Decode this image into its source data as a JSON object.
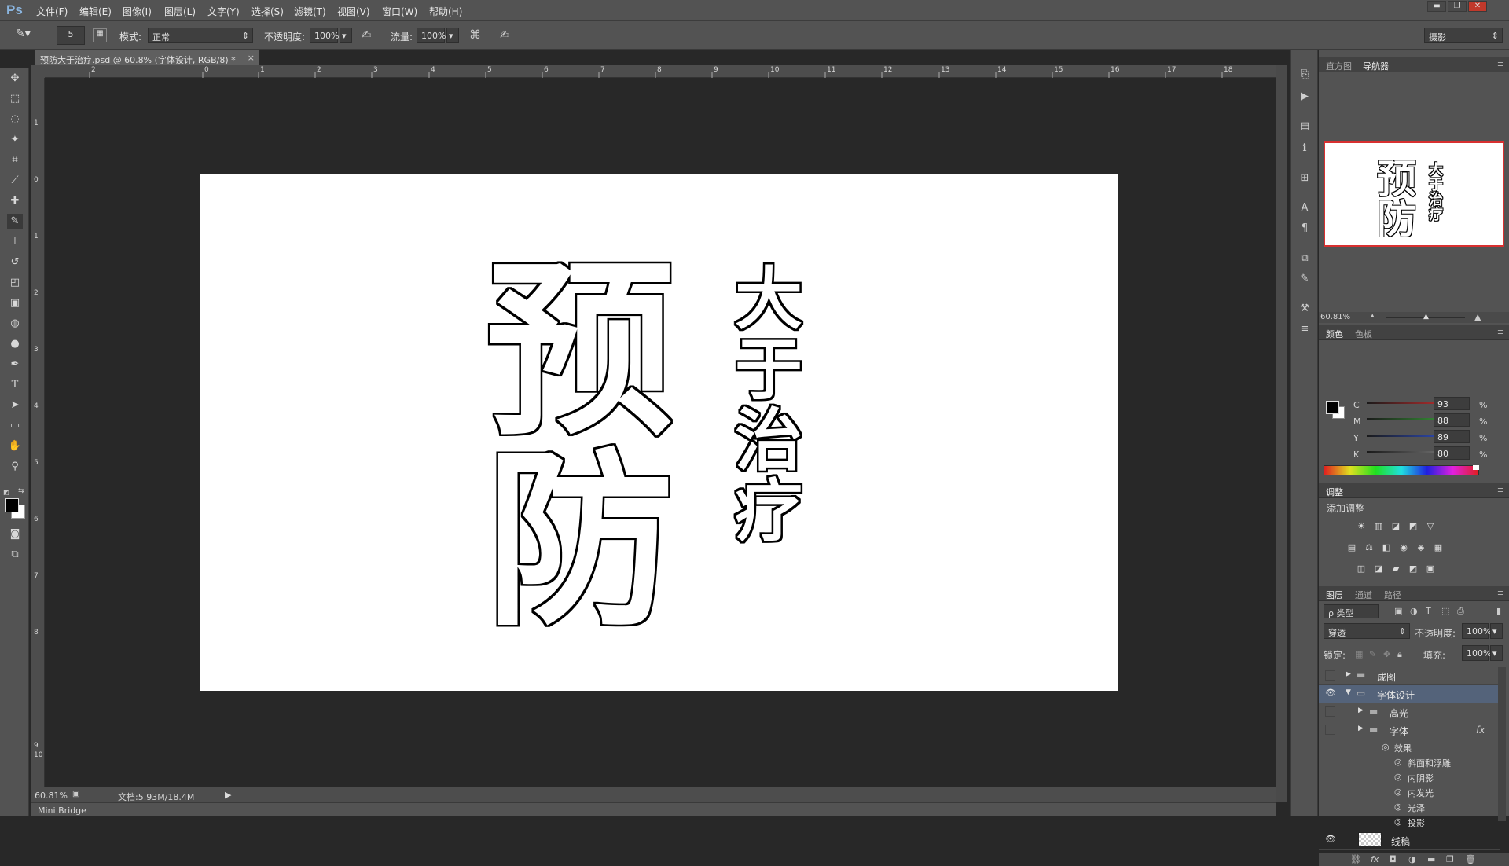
{
  "app": {
    "logo": "Ps"
  },
  "menu": [
    "文件(F)",
    "编辑(E)",
    "图像(I)",
    "图层(L)",
    "文字(Y)",
    "选择(S)",
    "滤镜(T)",
    "视图(V)",
    "窗口(W)",
    "帮助(H)"
  ],
  "window_controls": [
    "▬",
    "❐",
    "✕"
  ],
  "options": {
    "brush_size": "5",
    "mode_label": "模式:",
    "mode_value": "正常",
    "opacity_label": "不透明度:",
    "opacity_value": "100%",
    "flow_label": "流量:",
    "flow_value": "100%",
    "workspace": "摄影"
  },
  "document": {
    "tab_title": "预防大于治疗.psd @ 60.8% (字体设计, RGB/8) *",
    "ruler_h": [
      "2",
      "0",
      "1",
      "2",
      "3",
      "4",
      "5",
      "6",
      "7",
      "8",
      "9",
      "10",
      "11",
      "12",
      "13",
      "14",
      "15",
      "16",
      "17",
      "18"
    ],
    "ruler_v": [
      "1",
      "0",
      "1",
      "2",
      "3",
      "4",
      "5",
      "6",
      "7",
      "8",
      "9",
      "10"
    ]
  },
  "artwork": {
    "main_text_1": "预",
    "main_text_2": "防",
    "side_text": [
      "大",
      "于",
      "治",
      "疗"
    ]
  },
  "status": {
    "zoom": "60.81%",
    "doc_info": "文档:5.93M/18.4M",
    "mini_bridge": "Mini Bridge"
  },
  "navigator": {
    "tabs": [
      "直方图",
      "导航器"
    ],
    "zoom": "60.81%"
  },
  "color": {
    "tabs": [
      "颜色",
      "色板"
    ],
    "channels": [
      {
        "label": "C",
        "value": "93",
        "unit": "%",
        "color": "#c83030"
      },
      {
        "label": "M",
        "value": "88",
        "unit": "%",
        "color": "#3aa03a"
      },
      {
        "label": "Y",
        "value": "89",
        "unit": "%",
        "color": "#3050c8"
      },
      {
        "label": "K",
        "value": "80",
        "unit": "%",
        "color": "#7a7a7a"
      }
    ]
  },
  "adjustments": {
    "tab": "调整",
    "title": "添加调整",
    "row1": [
      "☀",
      "▥",
      "◪",
      "◩",
      "▽"
    ],
    "row2": [
      "▤",
      "⚖",
      "◧",
      "◉",
      "◈",
      "▦"
    ],
    "row3": [
      "◫",
      "◪",
      "▰",
      "◩",
      "▣"
    ]
  },
  "layers": {
    "tabs": [
      "图层",
      "通道",
      "路径"
    ],
    "filter_label": "ρ 类型",
    "blend_mode": "穿透",
    "opacity_label": "不透明度:",
    "opacity_value": "100%",
    "lock_label": "锁定:",
    "fill_label": "填充:",
    "fill_value": "100%",
    "items": [
      {
        "name": "成图",
        "visible": false,
        "type": "group",
        "level": 0,
        "expanded": false
      },
      {
        "name": "字体设计",
        "visible": true,
        "type": "group",
        "level": 0,
        "expanded": true,
        "selected": true
      },
      {
        "name": "高光",
        "visible": false,
        "type": "group",
        "level": 1,
        "expanded": false
      },
      {
        "name": "字体",
        "visible": false,
        "type": "group",
        "level": 1,
        "expanded": false,
        "fx": "fx"
      }
    ],
    "effects_title": "效果",
    "effects": [
      "斜面和浮雕",
      "内阴影",
      "内发光",
      "光泽",
      "投影"
    ],
    "bottom_layer": "线稿"
  }
}
